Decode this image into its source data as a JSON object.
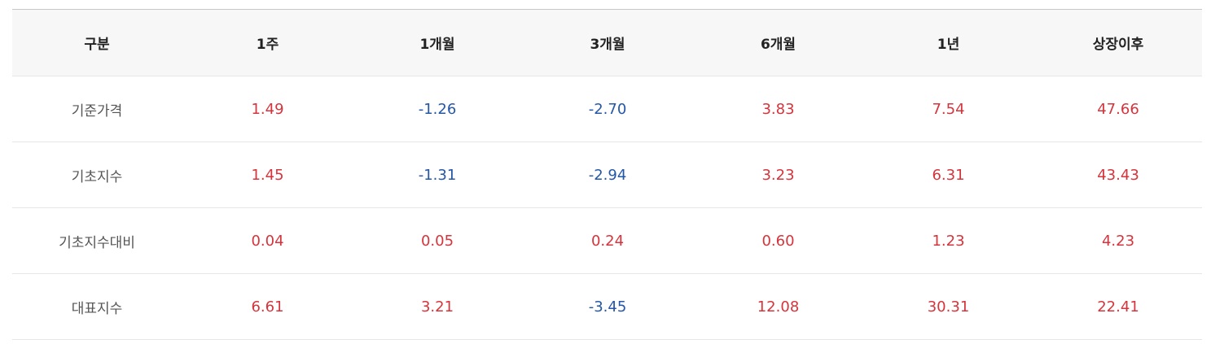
{
  "headers": [
    "구분",
    "1주",
    "1개월",
    "3개월",
    "6개월",
    "1년",
    "상장이후"
  ],
  "rows": [
    {
      "label": "기준가격",
      "values": [
        "1.49",
        "-1.26",
        "-2.70",
        "3.83",
        "7.54",
        "47.66"
      ]
    },
    {
      "label": "기초지수",
      "values": [
        "1.45",
        "-1.31",
        "-2.94",
        "3.23",
        "6.31",
        "43.43"
      ]
    },
    {
      "label": "기초지수대비",
      "values": [
        "0.04",
        "0.05",
        "0.24",
        "0.60",
        "1.23",
        "4.23"
      ]
    },
    {
      "label": "대표지수",
      "values": [
        "6.61",
        "3.21",
        "-3.45",
        "12.08",
        "30.31",
        "22.41"
      ]
    }
  ],
  "colors": {
    "positive": "#d6343c",
    "negative": "#2457a8",
    "header_bg": "#f7f7f7"
  }
}
